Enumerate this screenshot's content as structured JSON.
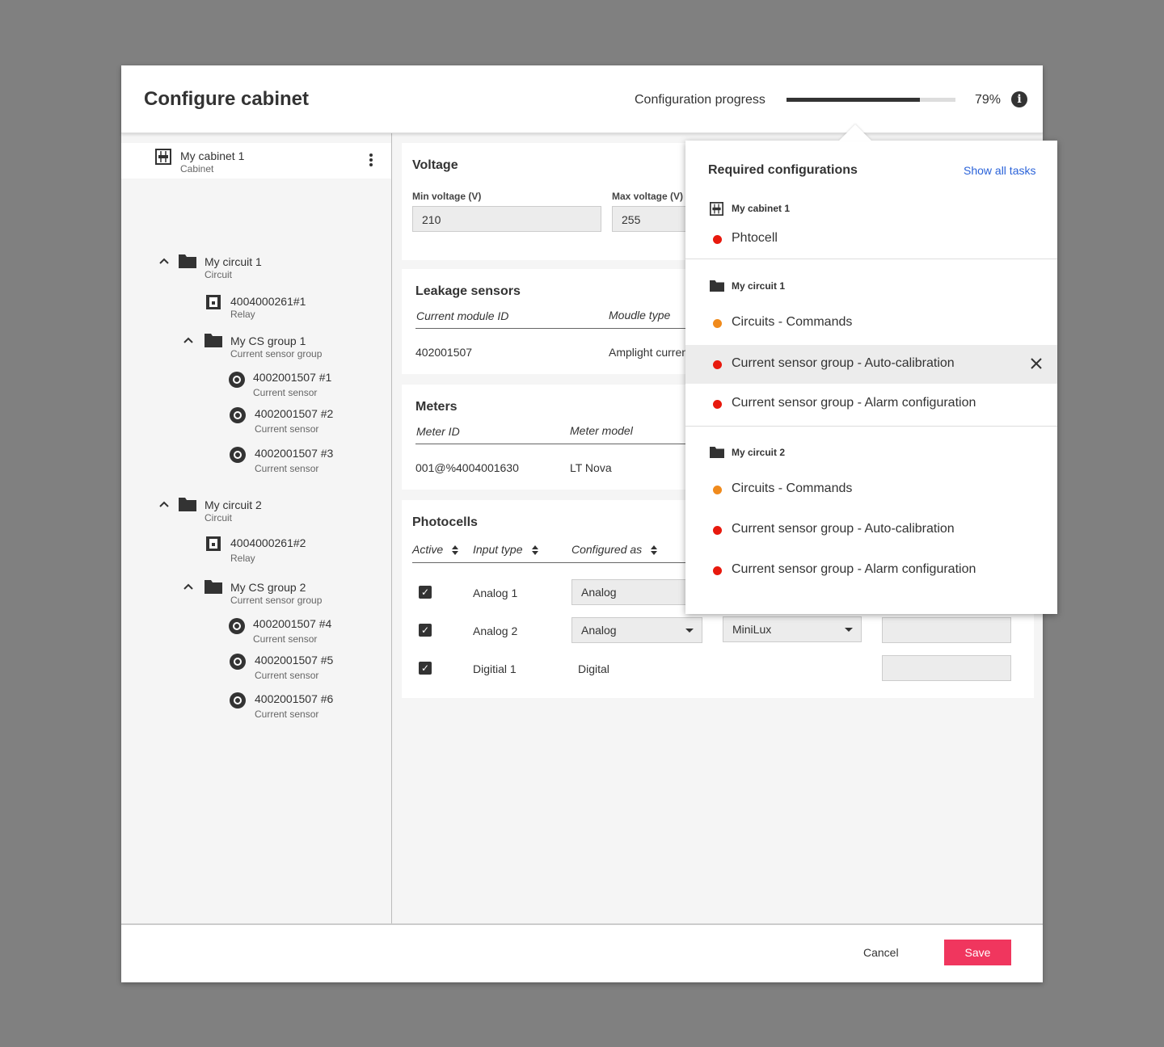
{
  "header": {
    "title": "Configure cabinet",
    "progress_label": "Configuration progress",
    "progress_value": 0.79,
    "progress_text": "79%",
    "info_glyph": "i"
  },
  "tree": {
    "cabinet": {
      "name": "My cabinet 1",
      "type": "Cabinet"
    },
    "circuit1": {
      "name": "My circuit 1",
      "type": "Circuit"
    },
    "relay1": {
      "name": "4004000261#1",
      "type": "Relay"
    },
    "csgroup1": {
      "name": "My CS group 1",
      "type": "Current sensor group"
    },
    "sensor1": {
      "name": "4002001507 #1",
      "type": "Current sensor"
    },
    "sensor2": {
      "name": "4002001507 #2",
      "type": "Current sensor"
    },
    "sensor3": {
      "name": "4002001507 #3",
      "type": "Current sensor"
    },
    "circuit2": {
      "name": "My circuit 2",
      "type": "Circuit"
    },
    "relay2": {
      "name": "4004000261#2",
      "type": "Relay"
    },
    "csgroup2": {
      "name": "My CS group 2",
      "type": "Current sensor group"
    },
    "sensor4": {
      "name": "4002001507 #4",
      "type": "Current sensor"
    },
    "sensor5": {
      "name": "4002001507 #5",
      "type": "Current sensor"
    },
    "sensor6": {
      "name": "4002001507 #6",
      "type": "Current sensor"
    }
  },
  "voltage": {
    "title": "Voltage",
    "min_label": "Min voltage (V)",
    "min_value": "210",
    "max_label": "Max voltage (V)",
    "max_value": "255"
  },
  "leakage": {
    "title": "Leakage sensors",
    "col1": "Current module ID",
    "col2": "Moudle type",
    "row_id": "402001507",
    "row_type": "Amplight curren"
  },
  "meters": {
    "title": "Meters",
    "col1": "Meter ID",
    "col2": "Meter model",
    "row_id": "001@%4004001630",
    "row_model": "LT Nova"
  },
  "photocells": {
    "title": "Photocells",
    "col_active": "Active",
    "col_input": "Input type",
    "col_configured": "Configured as",
    "check_glyph": "✓",
    "rows": [
      {
        "input": "Analog 1",
        "configured": "Analog"
      },
      {
        "input": "Analog 2",
        "configured": "Analog",
        "model": "MiniLux"
      },
      {
        "input": "Digitial 1",
        "configured": "Digital"
      }
    ]
  },
  "popover": {
    "title": "Required configurations",
    "show_all": "Show all tasks",
    "group1": "My cabinet 1",
    "group1_items": [
      "Phtocell"
    ],
    "group2": "My circuit 1",
    "group2_items": [
      "Circuits - Commands",
      "Current sensor group - Auto-calibration",
      "Current sensor group - Alarm configuration"
    ],
    "group3": "My circuit 2",
    "group3_items": [
      "Circuits - Commands",
      "Current sensor group - Auto-calibration",
      "Current sensor group - Alarm configuration"
    ],
    "colors": {
      "red": "#e8190d",
      "orange": "#f08a1c"
    }
  },
  "footer": {
    "cancel": "Cancel",
    "save": "Save"
  },
  "colors": {
    "accent": "#f0365e",
    "link": "#2b63d9"
  }
}
